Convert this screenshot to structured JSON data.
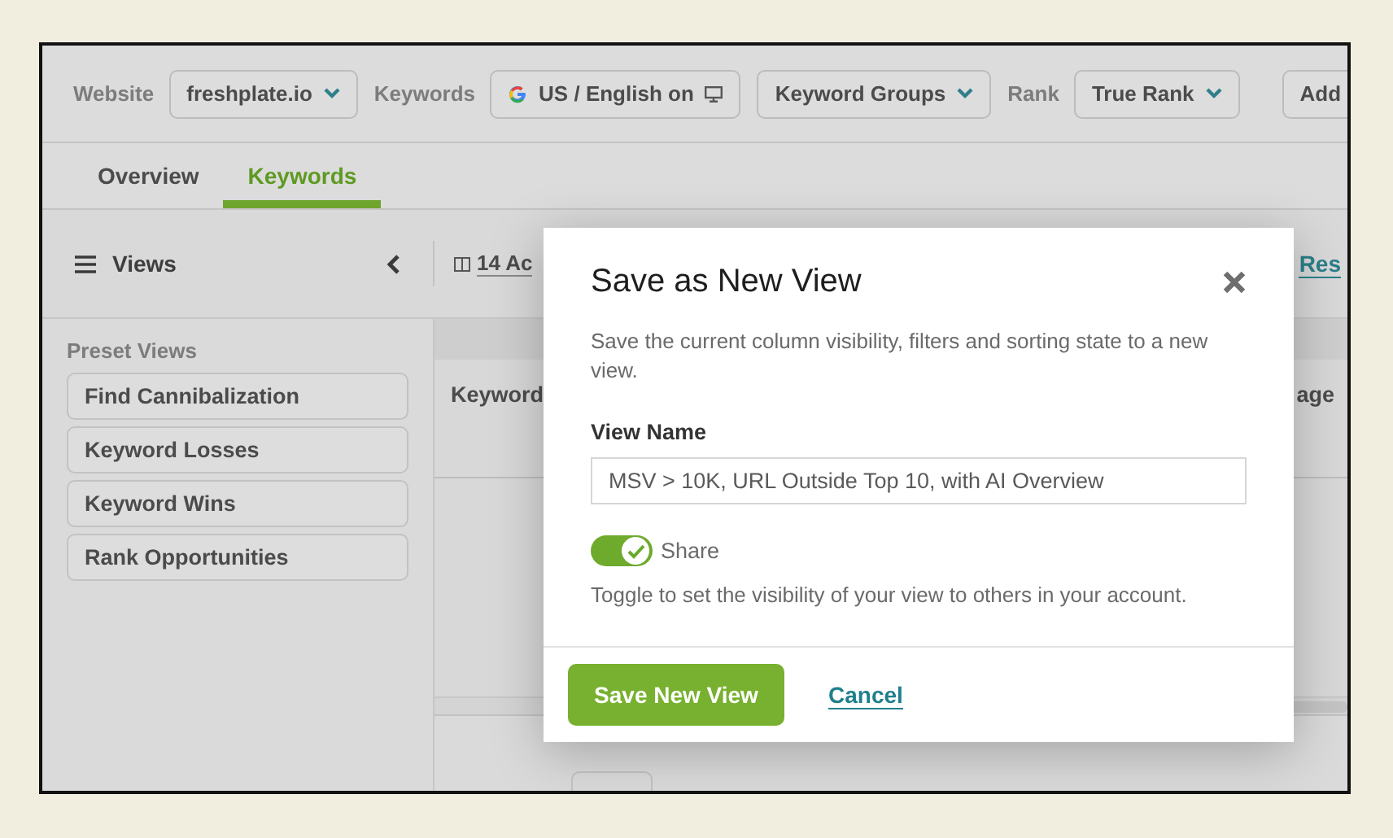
{
  "filter_bar": {
    "items": [
      {
        "kind": "label",
        "text": "Website"
      },
      {
        "kind": "dropdown",
        "text": "freshplate.io"
      },
      {
        "kind": "label",
        "text": "Keywords"
      },
      {
        "kind": "engine",
        "text": "US / English on"
      },
      {
        "kind": "dropdown",
        "text": "Keyword Groups"
      },
      {
        "kind": "label",
        "text": "Rank"
      },
      {
        "kind": "dropdown",
        "text": "True Rank"
      },
      {
        "kind": "button",
        "text": "Add"
      }
    ]
  },
  "tabs": [
    {
      "label": "Overview",
      "selected": false
    },
    {
      "label": "Keywords",
      "selected": true
    }
  ],
  "views_panel": {
    "title": "Views",
    "section": "Preset Views",
    "items": [
      "Find Cannibalization",
      "Keyword Losses",
      "Keyword Wins",
      "Rank Opportunities"
    ]
  },
  "toolbar": {
    "columns_button": "14 Ac",
    "reset_link": "Res"
  },
  "table": {
    "columns": [
      "Keyword",
      "age"
    ]
  },
  "dialog": {
    "title": "Save as New View",
    "description": "Save the current column visibility, filters and sorting state to a new view.",
    "field_label": "View Name",
    "field_value": "MSV > 10K, URL Outside Top 10, with AI Overview",
    "share": {
      "label": "Share",
      "on": true
    },
    "hint": "Toggle to set the visibility of your view to others in your account.",
    "buttons": [
      {
        "kind": "primary",
        "label": "Save New View"
      },
      {
        "kind": "link",
        "label": "Cancel"
      }
    ]
  }
}
